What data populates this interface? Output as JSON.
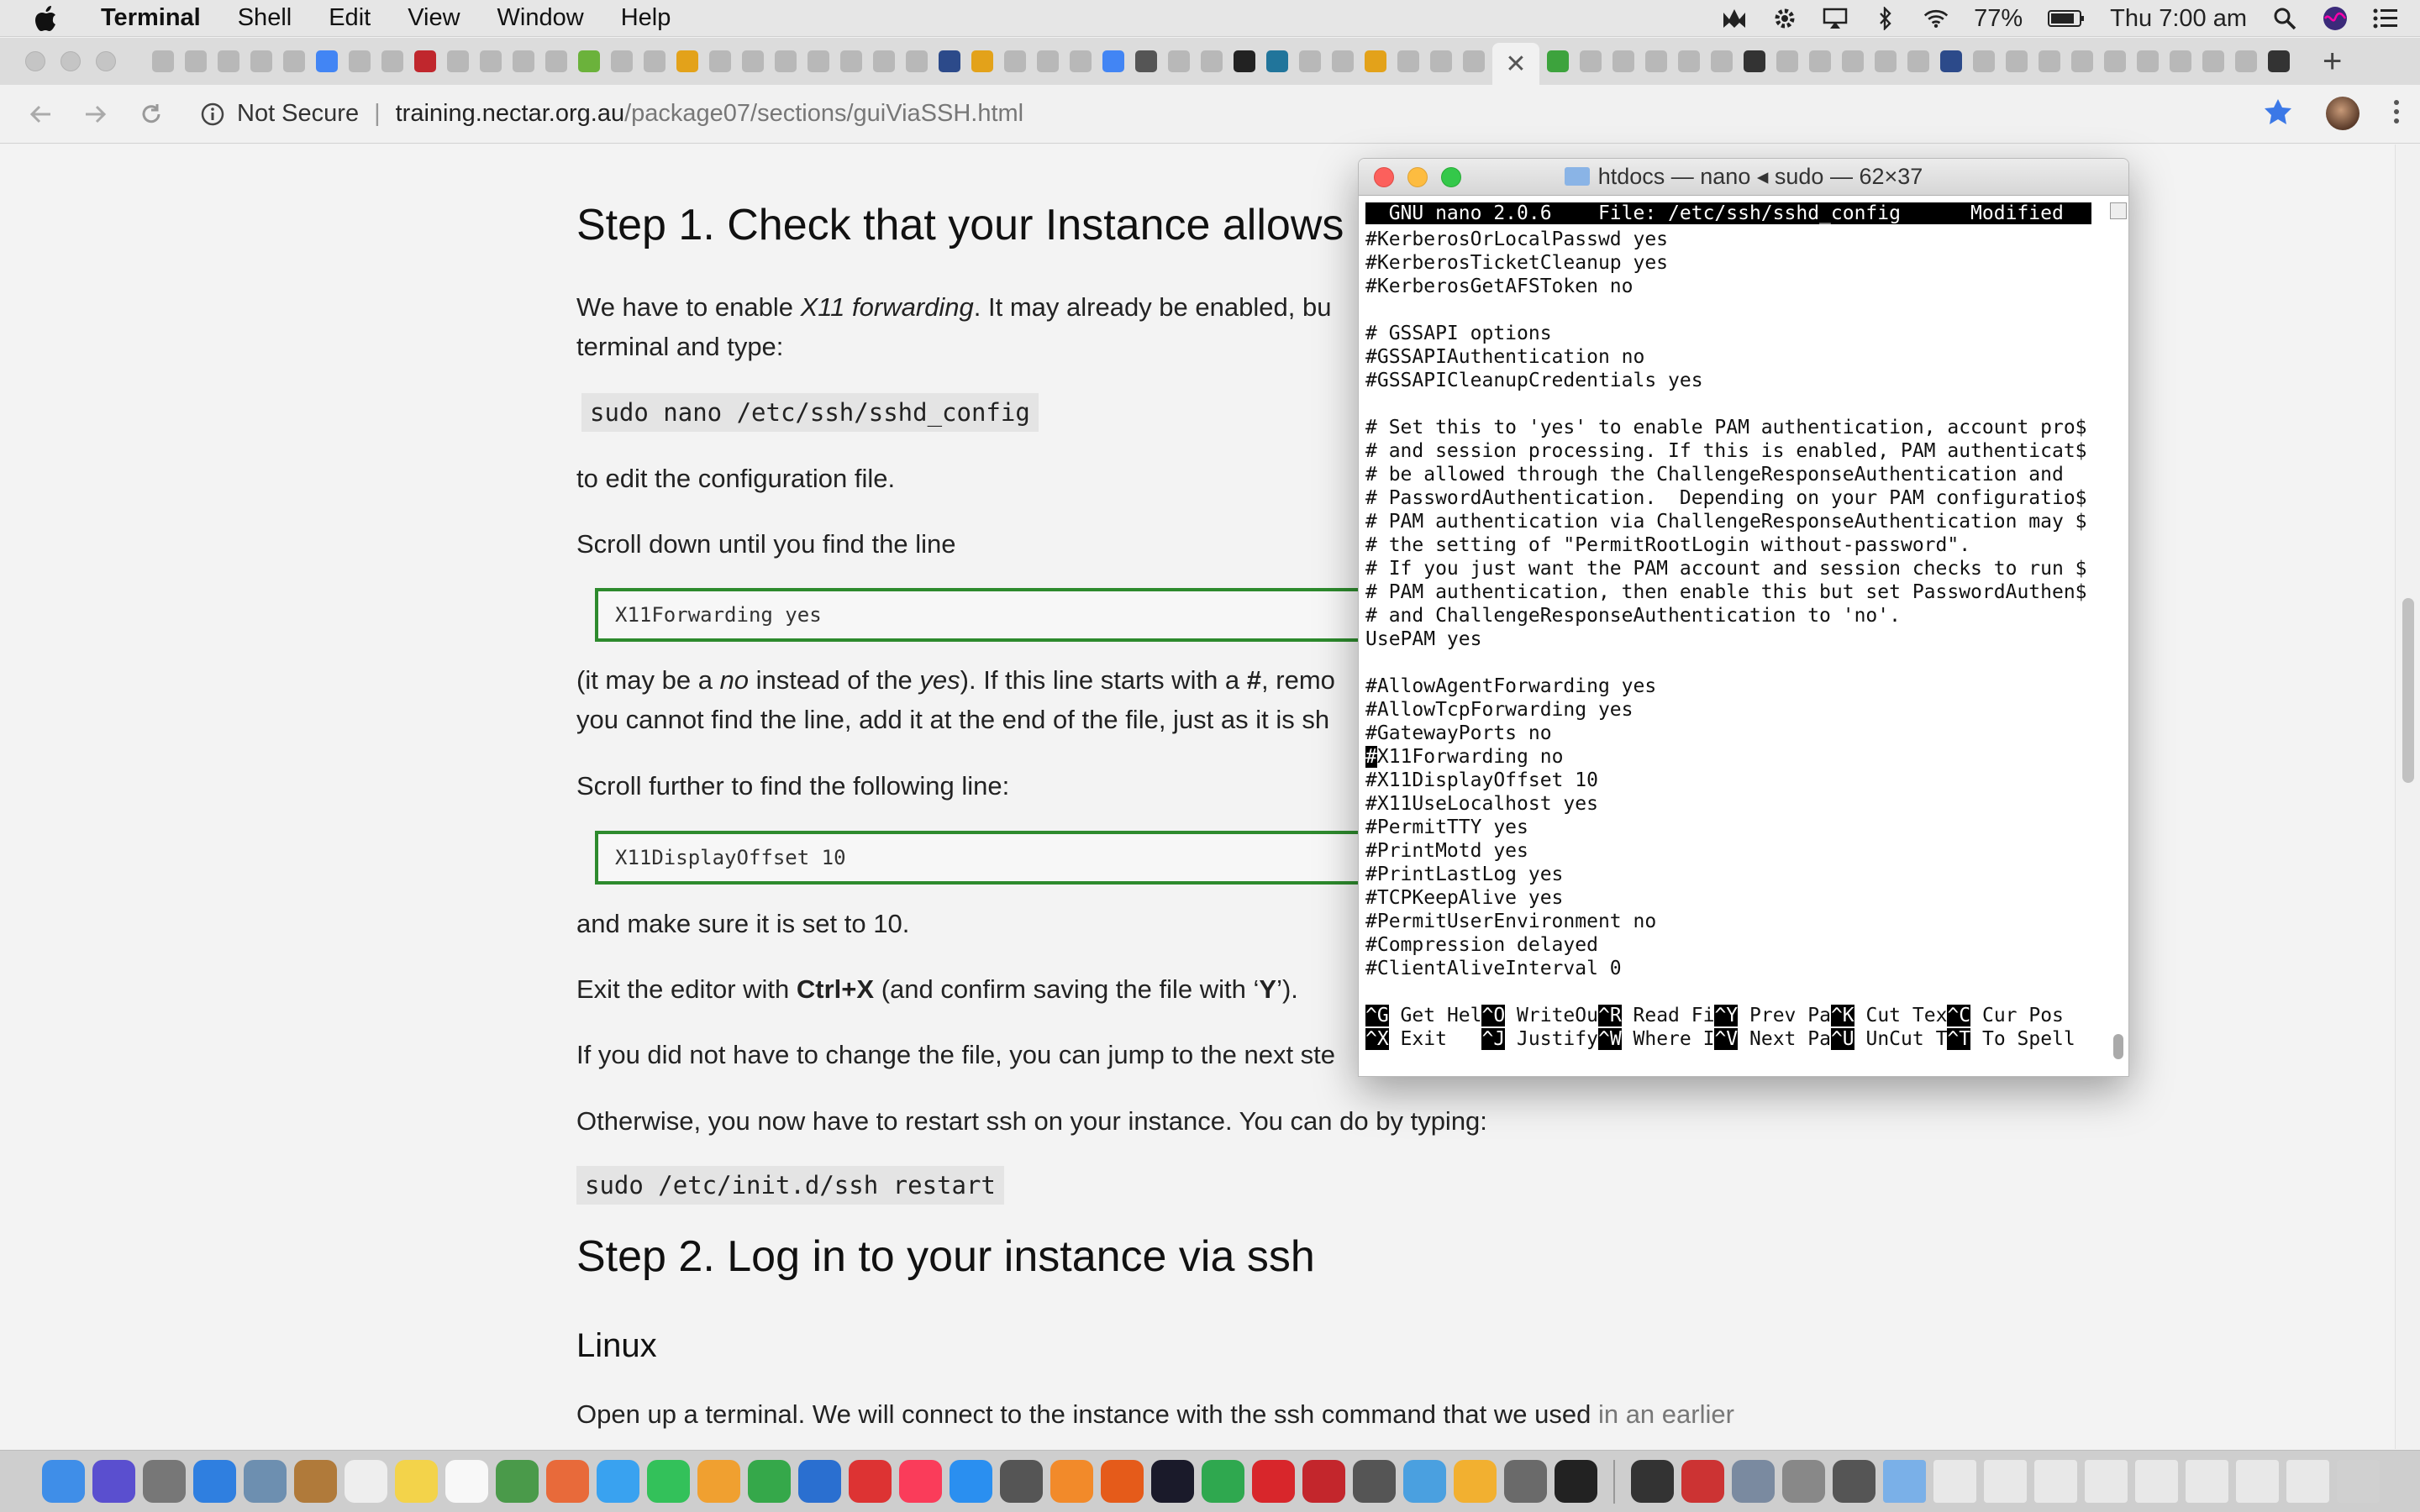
{
  "menubar": {
    "app_name": "Terminal",
    "items": [
      "Shell",
      "Edit",
      "View",
      "Window",
      "Help"
    ],
    "battery": "77%",
    "clock": "Thu 7:00 am"
  },
  "browser": {
    "address": {
      "security_label": "Not Secure",
      "host": "training.nectar.org.au",
      "path": "/package07/sections/guiViaSSH.html"
    }
  },
  "page": {
    "step1_title": "Step 1. Check that your Instance allows",
    "p1_a": "We have to enable ",
    "p1_em": "X11 forwarding",
    "p1_b": ". It may already be enabled, bu",
    "p1_line2": "terminal and type:",
    "cmd_edit": "sudo nano /etc/ssh/sshd_config",
    "p2": "to edit the configuration file.",
    "p3": "Scroll down until you find the line",
    "code1": "X11Forwarding yes",
    "p4_a": "(it may be a ",
    "p4_no": "no",
    "p4_b": " instead of the ",
    "p4_yes": "yes",
    "p4_c": "). If this line starts with a ",
    "p4_hash": "#",
    "p4_d": ", remo",
    "p4_line2": "you cannot find the line, add it at the end of the file, just as it is sh",
    "p5": "Scroll further to find the following line:",
    "code2": "X11DisplayOffset 10",
    "p6": "and make sure it is set to 10.",
    "p7_a": "Exit the editor with ",
    "p7_key": "Ctrl+X",
    "p7_b": " (and confirm saving the file with ‘",
    "p7_y": "Y",
    "p7_c": "’).",
    "p8": "If you did not have to change the file, you can jump to the next ste",
    "p9": "Otherwise, you now have to restart ssh on your instance. You can do by typing:",
    "cmd_restart": "sudo /etc/init.d/ssh restart",
    "step2_title": "Step 2. Log in to your instance via ssh",
    "linux_title": "Linux",
    "p10_a": "Open up a terminal. We will connect to the instance with the ssh command that we used ",
    "p10_link": "in an earlier"
  },
  "terminal": {
    "title": "htdocs — nano ◂ sudo — 62×37",
    "nano_header": "  GNU nano 2.0.6    File: /etc/ssh/sshd_config      Modified  ",
    "lines": [
      "#KerberosOrLocalPasswd yes",
      "#KerberosTicketCleanup yes",
      "#KerberosGetAFSToken no",
      "",
      "# GSSAPI options",
      "#GSSAPIAuthentication no",
      "#GSSAPICleanupCredentials yes",
      "",
      "# Set this to 'yes' to enable PAM authentication, account pro$",
      "# and session processing. If this is enabled, PAM authenticat$",
      "# be allowed through the ChallengeResponseAuthentication and",
      "# PasswordAuthentication.  Depending on your PAM configuratio$",
      "# PAM authentication via ChallengeResponseAuthentication may $",
      "# the setting of \"PermitRootLogin without-password\".",
      "# If you just want the PAM account and session checks to run $",
      "# PAM authentication, then enable this but set PasswordAuthen$",
      "# and ChallengeResponseAuthentication to 'no'.",
      "UsePAM yes",
      "",
      "#AllowAgentForwarding yes",
      "#AllowTcpForwarding yes",
      "#GatewayPorts no",
      "X11Forwarding no",
      "#X11DisplayOffset 10",
      "#X11UseLocalhost yes",
      "#PermitTTY yes",
      "#PrintMotd yes",
      "#PrintLastLog yes",
      "#TCPKeepAlive yes",
      "#PermitUserEnvironment no",
      "#Compression delayed",
      "#ClientAliveInterval 0"
    ],
    "cursor_char": "#",
    "shortcuts_row1": [
      {
        "key": "^G",
        "label": " Get Hel"
      },
      {
        "key": "^O",
        "label": " WriteOu"
      },
      {
        "key": "^R",
        "label": " Read Fi"
      },
      {
        "key": "^Y",
        "label": " Prev Pa"
      },
      {
        "key": "^K",
        "label": " Cut Tex"
      },
      {
        "key": "^C",
        "label": " Cur Pos"
      }
    ],
    "shortcuts_row2": [
      {
        "key": "^X",
        "label": " Exit   "
      },
      {
        "key": "^J",
        "label": " Justify"
      },
      {
        "key": "^W",
        "label": " Where I"
      },
      {
        "key": "^V",
        "label": " Next Pa"
      },
      {
        "key": "^U",
        "label": " UnCut T"
      },
      {
        "key": "^T",
        "label": " To Spell"
      }
    ]
  },
  "colors": {
    "code_border": "#2d8a2d",
    "traffic_red": "#fc605c",
    "traffic_yellow": "#fdbc40",
    "traffic_green": "#34c84a",
    "bookmark_star": "#3b78e7"
  }
}
